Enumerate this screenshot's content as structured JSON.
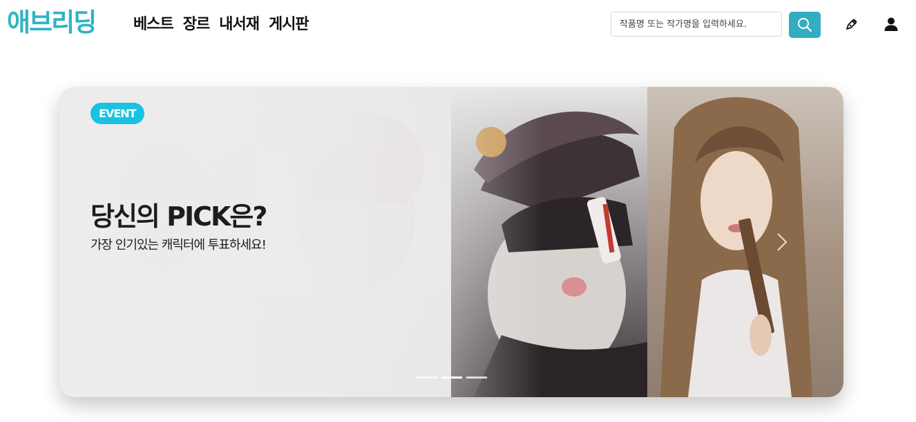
{
  "header": {
    "logo": "애브리딩",
    "nav": [
      "베스트",
      "장르",
      "내서재",
      "게시판"
    ],
    "search": {
      "placeholder": "작품명 또는 작가명을 입력하세요.",
      "value": ""
    },
    "icons": {
      "search": "search-icon",
      "write": "pen-icon",
      "user": "user-icon"
    },
    "colors": {
      "brand": "#2fb4c3",
      "search_button": "#33adc2"
    }
  },
  "banner": {
    "badge": "EVENT",
    "title": "당신의 PICK은?",
    "subtitle": "가장 인기있는 캐릭터에 투표하세요!",
    "slide_count": 3,
    "active_slide": 2,
    "colors": {
      "badge": "#18c2e2"
    },
    "icons": {
      "next": "chevron-right-icon"
    }
  }
}
